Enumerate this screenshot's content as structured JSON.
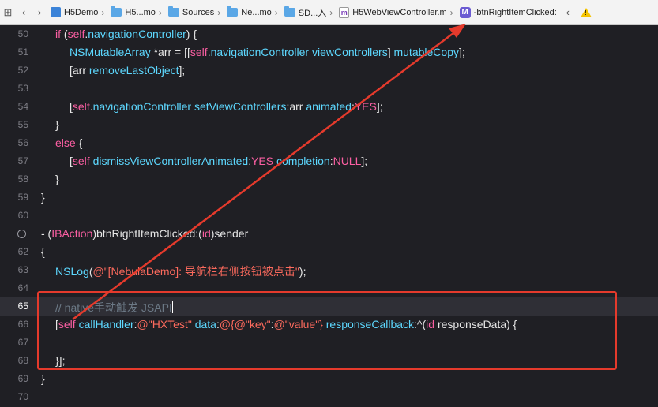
{
  "jumpbar": {
    "crumbs": [
      {
        "label": "H5Demo",
        "icon": "project-icon"
      },
      {
        "label": "H5...mo",
        "icon": "folder-icon"
      },
      {
        "label": "Sources",
        "icon": "folder-icon"
      },
      {
        "label": "Ne...mo",
        "icon": "folder-icon"
      },
      {
        "label": "SD...入",
        "icon": "folder-icon"
      },
      {
        "label": "H5WebViewController.m",
        "icon": "m-file-icon"
      },
      {
        "label": "-btnRightItemClicked:",
        "icon": "method-icon"
      }
    ]
  },
  "editor": {
    "current_line": "65",
    "lines": [
      {
        "num": "50"
      },
      {
        "num": "51"
      },
      {
        "num": "52"
      },
      {
        "num": "53"
      },
      {
        "num": "54"
      },
      {
        "num": "55"
      },
      {
        "num": "56"
      },
      {
        "num": "57"
      },
      {
        "num": "58"
      },
      {
        "num": "59"
      },
      {
        "num": "60"
      },
      {
        "num": ""
      },
      {
        "num": "62"
      },
      {
        "num": "63"
      },
      {
        "num": "64"
      },
      {
        "num": "65"
      },
      {
        "num": "66"
      },
      {
        "num": "67"
      },
      {
        "num": "68"
      },
      {
        "num": "69"
      },
      {
        "num": "70"
      }
    ],
    "tokens": {
      "l50": [
        "if",
        " (",
        "self",
        ".",
        "navigationController",
        ") {"
      ],
      "l51": [
        "NSMutableArray",
        " *arr = [[",
        "self",
        ".",
        "navigationController",
        " ",
        "viewControllers",
        "] ",
        "mutableCopy",
        "];"
      ],
      "l52": [
        "[arr ",
        "removeLastObject",
        "];"
      ],
      "l54": [
        "[",
        "self",
        ".",
        "navigationController",
        " ",
        "setViewControllers",
        ":arr ",
        "animated",
        ":",
        "YES",
        "];"
      ],
      "l55": [
        "}"
      ],
      "l56": [
        "else",
        " {"
      ],
      "l57": [
        "[",
        "self",
        " ",
        "dismissViewControllerAnimated",
        ":",
        "YES",
        " ",
        "completion",
        ":",
        "NULL",
        "];"
      ],
      "l58": [
        "}"
      ],
      "l59": [
        "}"
      ],
      "l61": [
        "- (",
        "IBAction",
        ")btnRightItemClicked:(",
        "id",
        ")sender"
      ],
      "l62": [
        "{"
      ],
      "l63": [
        "NSLog",
        "(",
        "@\"[NebulaDemo]: 导航栏右侧按钮被点击\"",
        ");"
      ],
      "l65": [
        "// native手动触发 JSAPI"
      ],
      "l66": [
        "[",
        "self",
        " ",
        "callHandler",
        ":",
        "@\"HXTest\"",
        " ",
        "data",
        ":",
        "@{",
        "@\"key\"",
        ":",
        "@\"value\"",
        "}",
        " ",
        "responseCallback",
        ":^(",
        "id",
        " responseData) {"
      ],
      "l68": [
        "}];"
      ],
      "l69": [
        "}"
      ]
    }
  },
  "colors": {
    "keyword": "#fc5fa3",
    "type": "#5dd8ff",
    "method": "#a6e22e",
    "string": "#fc6a5d",
    "comment": "#6c7986",
    "annotation": "#e53a2c"
  }
}
